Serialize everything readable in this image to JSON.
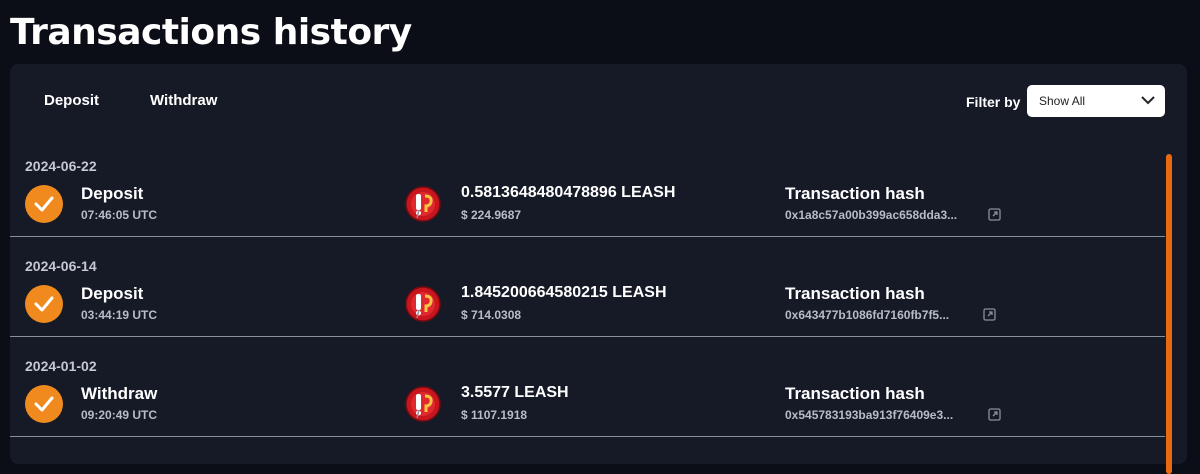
{
  "page": {
    "title": "Transactions history"
  },
  "tabs": {
    "deposit": "Deposit",
    "withdraw": "Withdraw"
  },
  "filter": {
    "label": "Filter by",
    "selected": "Show All"
  },
  "colors": {
    "accent": "#f08a1f",
    "scrollbar": "#e8690f",
    "panel": "#161a26",
    "background": "#0b0e17"
  },
  "transactions": [
    {
      "date": "2024-06-22",
      "type": "Deposit",
      "time": "07:46:05 UTC",
      "amount": "0.5813648480478896 LEASH",
      "usd": "$ 224.9687",
      "hash_label": "Transaction hash",
      "hash": "0x1a8c57a00b399ac658dda3...",
      "status_icon": "check-icon",
      "token_icon": "leash-token-icon",
      "link_icon": "external-link-icon"
    },
    {
      "date": "2024-06-14",
      "type": "Deposit",
      "time": "03:44:19 UTC",
      "amount": "1.845200664580215 LEASH",
      "usd": "$ 714.0308",
      "hash_label": "Transaction hash",
      "hash": "0x643477b1086fd7160fb7f5...",
      "status_icon": "check-icon",
      "token_icon": "leash-token-icon",
      "link_icon": "external-link-icon"
    },
    {
      "date": "2024-01-02",
      "type": "Withdraw",
      "time": "09:20:49 UTC",
      "amount": "3.5577 LEASH",
      "usd": "$ 1107.1918",
      "hash_label": "Transaction hash",
      "hash": "0x545783193ba913f76409e3...",
      "status_icon": "check-icon",
      "token_icon": "leash-token-icon",
      "link_icon": "external-link-icon"
    }
  ]
}
